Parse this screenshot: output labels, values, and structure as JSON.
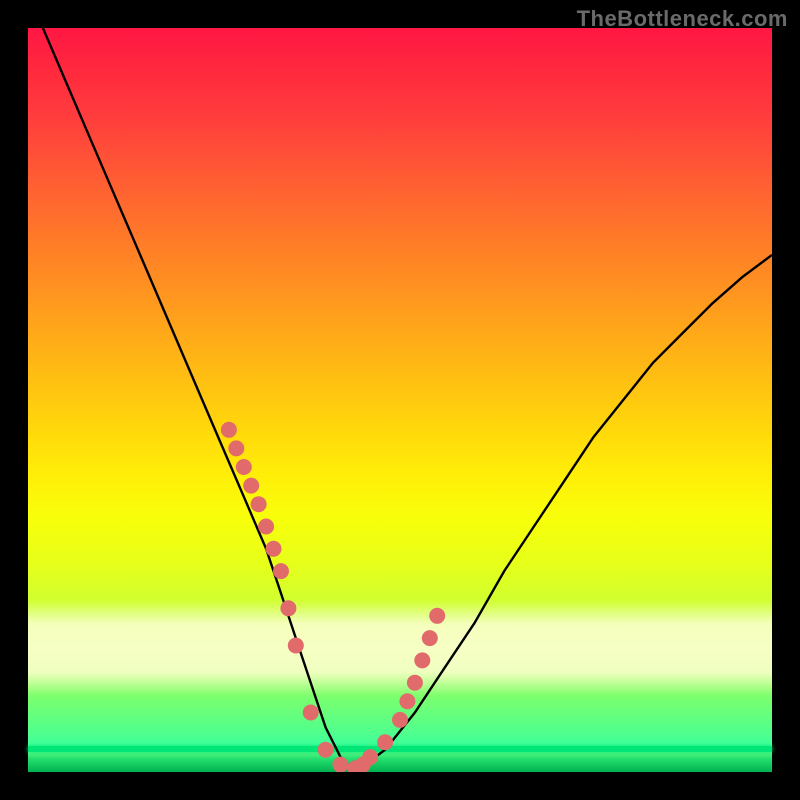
{
  "watermark": "TheBottleneck.com",
  "chart_data": {
    "type": "line",
    "title": "",
    "xlabel": "",
    "ylabel": "",
    "xlim": [
      0,
      100
    ],
    "ylim": [
      0,
      100
    ],
    "series": [
      {
        "name": "bottleneck-curve",
        "x": [
          2,
          5,
          8,
          11,
          14,
          17,
          20,
          23,
          26,
          29,
          32,
          34,
          36,
          38,
          40,
          42,
          44,
          48,
          52,
          56,
          60,
          64,
          68,
          72,
          76,
          80,
          84,
          88,
          92,
          96,
          100
        ],
        "y": [
          100,
          93,
          86,
          79,
          72,
          65,
          58,
          51,
          44,
          37,
          30,
          24,
          18,
          12,
          6,
          2,
          0,
          3,
          8,
          14,
          20,
          27,
          33,
          39,
          45,
          50,
          55,
          59,
          63,
          66.5,
          69.5
        ]
      }
    ],
    "markers": {
      "name": "sample-points",
      "x": [
        27,
        28,
        29,
        30,
        31,
        32,
        33,
        34,
        35,
        36,
        38,
        40,
        42,
        44,
        45,
        46,
        48,
        50,
        51,
        52,
        53,
        54,
        55
      ],
      "y": [
        46,
        43.5,
        41,
        38.5,
        36,
        33,
        30,
        27,
        22,
        17,
        8,
        3,
        1,
        0.5,
        1,
        2,
        4,
        7,
        9.5,
        12,
        15,
        18,
        21
      ]
    },
    "bands": [
      {
        "name": "pale-yellow-band",
        "y_from": 7,
        "y_to": 23,
        "color": "#ffffd2"
      },
      {
        "name": "green-zero-band",
        "y_from": 0,
        "y_to": 3,
        "color": "#00c853"
      }
    ]
  }
}
